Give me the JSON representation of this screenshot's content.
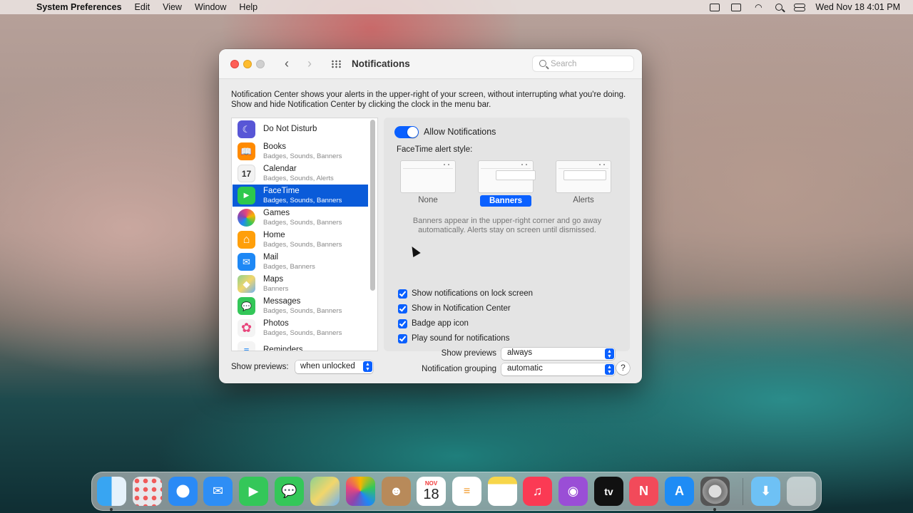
{
  "menubar": {
    "app": "System Preferences",
    "menus": [
      "Edit",
      "View",
      "Window",
      "Help"
    ],
    "clock": "Wed Nov 18  4:01 PM"
  },
  "window": {
    "title": "Notifications",
    "search_placeholder": "Search",
    "description": "Notification Center shows your alerts in the upper-right of your screen, without interrupting what you're doing. Show and hide Notification Center by clicking the clock in the menu bar."
  },
  "apps": [
    {
      "name": "Do Not Disturb",
      "sub": "",
      "color": "#5856d6",
      "glyph": "☾"
    },
    {
      "name": "Books",
      "sub": "Badges, Sounds, Banners",
      "color": "#ff8a00",
      "glyph": "📖"
    },
    {
      "name": "Calendar",
      "sub": "Badges, Sounds, Alerts",
      "color": "#f2f2f2",
      "glyph": "17"
    },
    {
      "name": "FaceTime",
      "sub": "Badges, Sounds, Banners",
      "color": "#2dc84d",
      "glyph": "▶"
    },
    {
      "name": "Games",
      "sub": "Badges, Sounds, Banners",
      "color": "#e8467c",
      "glyph": "●"
    },
    {
      "name": "Home",
      "sub": "Badges, Sounds, Banners",
      "color": "#ff9f0a",
      "glyph": "⌂"
    },
    {
      "name": "Mail",
      "sub": "Badges, Banners",
      "color": "#1e88f5",
      "glyph": "✉"
    },
    {
      "name": "Maps",
      "sub": "Banners",
      "color": "#5dbb63",
      "glyph": "◆"
    },
    {
      "name": "Messages",
      "sub": "Badges, Sounds, Banners",
      "color": "#34c759",
      "glyph": "💬"
    },
    {
      "name": "Photos",
      "sub": "Badges, Sounds, Banners",
      "color": "#f4f4f4",
      "glyph": "✿"
    },
    {
      "name": "Reminders",
      "sub": "",
      "color": "#f4f4f4",
      "glyph": "≡"
    }
  ],
  "selected_app": "FaceTime",
  "pane": {
    "allow_label": "Allow Notifications",
    "style_label": "FaceTime alert style:",
    "styles": [
      "None",
      "Banners",
      "Alerts"
    ],
    "selected_style": "Banners",
    "explain": "Banners appear in the upper-right corner and go away automatically. Alerts stay on screen until dismissed.",
    "checks": [
      "Show notifications on lock screen",
      "Show in Notification Center",
      "Badge app icon",
      "Play sound for notifications"
    ],
    "previews_label": "Show previews",
    "previews_value": "always",
    "grouping_label": "Notification grouping",
    "grouping_value": "automatic"
  },
  "footer": {
    "previews_label": "Show previews:",
    "previews_value": "when unlocked",
    "help": "?"
  },
  "dock": {
    "calendar_month": "NOV",
    "calendar_day": "18",
    "tv_label": "tv"
  },
  "colors": {
    "accent": "#0a60ff",
    "selection": "#0a5bd9"
  }
}
